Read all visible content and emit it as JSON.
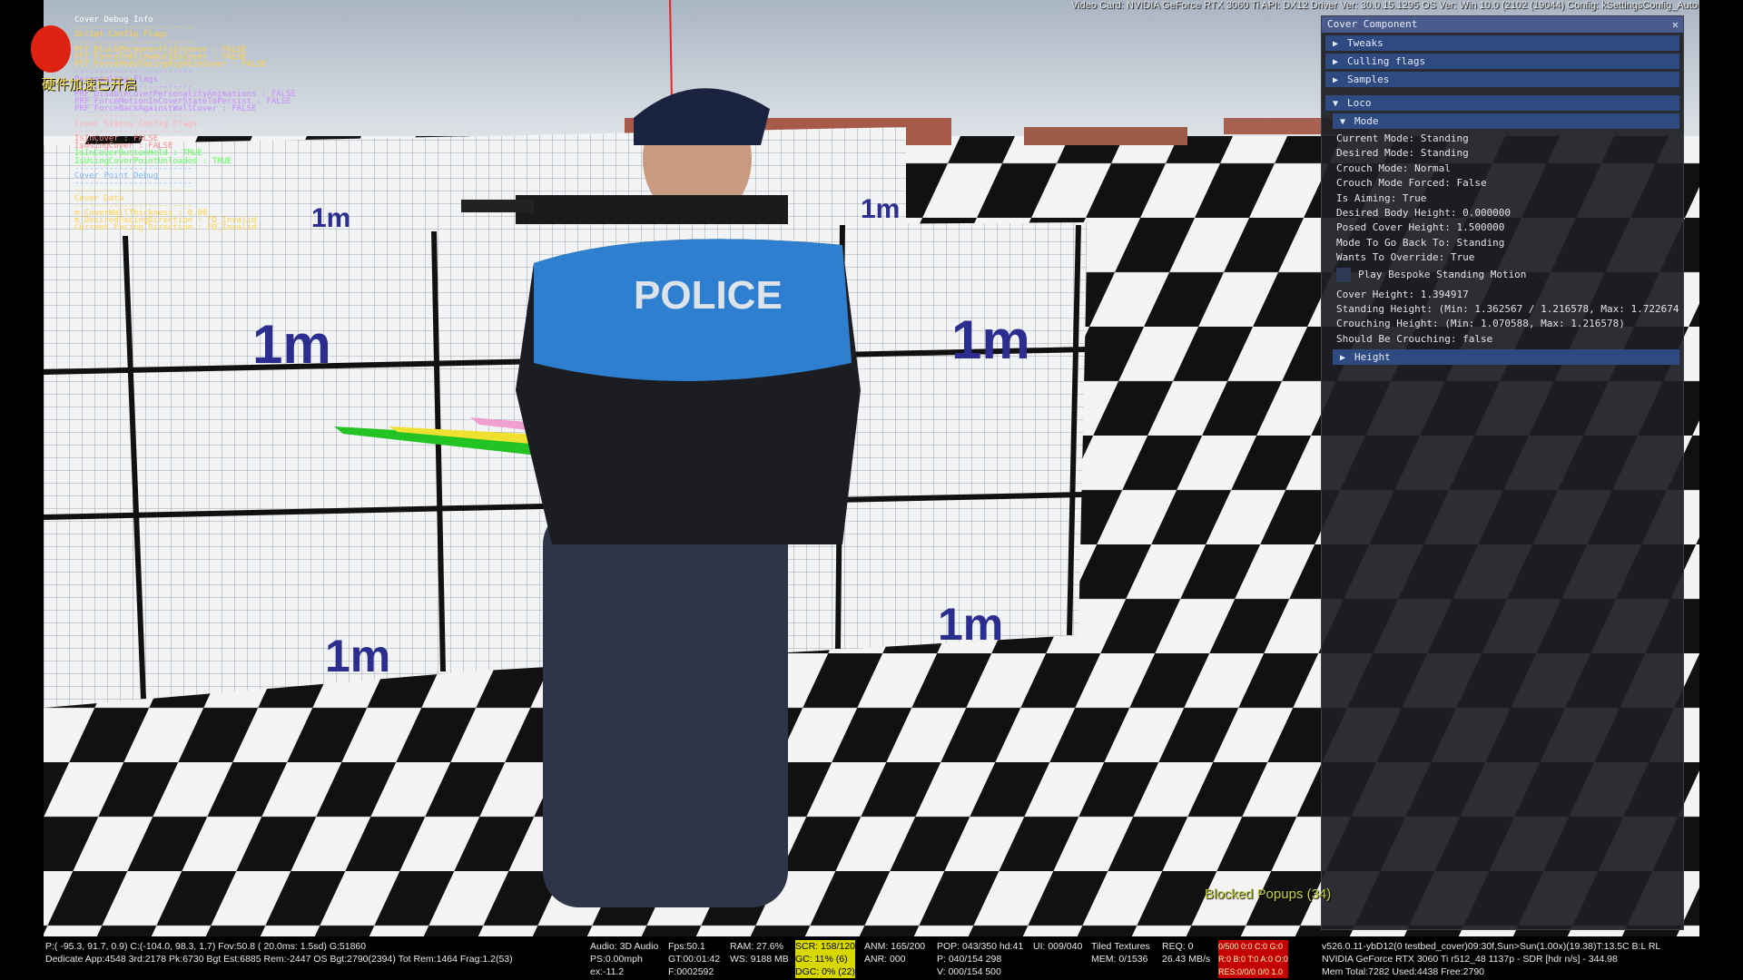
{
  "top_info": "Video Card: NVIDIA GeForce RTX 3060 Ti API: DX12 Driver Ver: 30.0.15.1295 OS Ver: Win 10.0 (2102 (19044) Config: kSettingsConfig_Auto",
  "ime_indicator": "硬件加速已开启",
  "debug_lines": [
    {
      "text": "Cover Debug Info",
      "color": "#ffffff"
    },
    {
      "text": "------------------------",
      "color": "#ffd24a"
    },
    {
      "text": "Script Config Flags",
      "color": "#ffd24a"
    },
    {
      "text": "------------------------",
      "color": "#ffd24a"
    },
    {
      "text": "PCF_BlockPermanentlyInCover : FALSE",
      "color": "#ffd24a"
    },
    {
      "text": "PCF_ForceToAllowAutoInCover : FALSE",
      "color": "#ffd24a"
    },
    {
      "text": "PCF_ForcePedsFacingRightInCover : FALSE",
      "color": "#ffd24a"
    },
    {
      "text": "------------------------",
      "color": "#c98bff"
    },
    {
      "text": "Personality Flags",
      "color": "#c98bff"
    },
    {
      "text": "------------------------",
      "color": "#c98bff"
    },
    {
      "text": "PRF_DisableCoverPersonalityAnimations : FALSE",
      "color": "#c98bff"
    },
    {
      "text": "PRF_ForceMotionInCoverStateToPersist : FALSE",
      "color": "#c98bff"
    },
    {
      "text": "PRF_ForceBackAgainstWallCover : FALSE",
      "color": "#c98bff"
    },
    {
      "text": "------------------------",
      "color": "#ffb0b0"
    },
    {
      "text": "Cover Status Config Flags",
      "color": "#ffb0b0"
    },
    {
      "text": "------------------------",
      "color": "#ffb0b0"
    },
    {
      "text": "IsInCover : FALSE",
      "color": "#ff8a8a"
    },
    {
      "text": "IsUsingCover : FALSE",
      "color": "#ff8a8a"
    },
    {
      "text": "IsInCoverButtonHeld : TRUE",
      "color": "#5cff5c"
    },
    {
      "text": "IsUsingCoverPointUnloaded : TRUE",
      "color": "#5cff5c"
    },
    {
      "text": "------------------------",
      "color": "#7fb6ff"
    },
    {
      "text": "Cover Point Debug",
      "color": "#7fb6ff"
    },
    {
      "text": "------------------------",
      "color": "#7fb6ff"
    },
    {
      "text": "------------------------",
      "color": "#ffd24a"
    },
    {
      "text": "Cover Data",
      "color": "#ffd24a"
    },
    {
      "text": "------------------------",
      "color": "#ffd24a"
    },
    {
      "text": "m_CoverWallThickness : 0.00",
      "color": "#ffd24a"
    },
    {
      "text": "m_DesiredFacingDirection : FD_Invalid",
      "color": "#ffd24a"
    },
    {
      "text": "Current Facing Direction : FD_Invalid",
      "color": "#ffd24a"
    }
  ],
  "panel": {
    "title": "Cover Component",
    "close_glyph": "✕",
    "collapsed_arrow": "▶",
    "expanded_arrow": "▼",
    "sections": {
      "tweaks": "Tweaks",
      "culling_flags": "Culling flags",
      "samples": "Samples",
      "loco": "Loco",
      "mode": "Mode",
      "height": "Height"
    },
    "mode_rows": [
      "Current Mode: Standing",
      "Desired Mode: Standing",
      "Crouch Mode: Normal",
      "Crouch Mode Forced: False",
      "Is Aiming: True",
      "Desired Body Height: 0.000000",
      "Posed Cover Height: 1.500000",
      "Mode To Go Back To: Standing",
      "Wants To Override: True"
    ],
    "checkbox_label": "Play Bespoke Standing Motion",
    "height_rows": [
      "Cover Height: 1.394917",
      "Standing Height: (Min: 1.362567 / 1.216578, Max: 1.722674",
      "Crouching Height: (Min: 1.070588, Max: 1.216578)",
      "Should Be Crouching: false"
    ]
  },
  "blocked_popups": "Blocked Popups (34)",
  "scene_labels": {
    "meter": "1m",
    "jersey": "POLICE"
  },
  "bottom": {
    "col1": [
      "P:( -95.3, 91.7, 0.9) C:(-104.0, 98.3, 1.7) Fov:50.8 ( 20.0ms: 1.5sd) G:51860",
      "Dedicate App:4548 3rd:2178 Pk:6730 Bgt Est:6885 Rem:-2447 OS Bgt:2790(2394) Tot Rem:1464 Frag:1.2(53)"
    ],
    "col2": [
      "Audio: 3D Audio",
      "PS:0.00mph",
      "ex:-11.2"
    ],
    "col3": [
      "Fps:50.1",
      "GT:00:01:42",
      "F:0002592"
    ],
    "col4": [
      "RAM: 27.6%",
      "WS: 9188 MB"
    ],
    "col5": [
      "SCR: 158/120",
      "GC: 11% (6)",
      "DGC: 0% (22)"
    ],
    "col6": [
      "ANM: 165/200",
      "ANR: 000"
    ],
    "col7": [
      "POP: 043/350 hd:41",
      "P: 040/154 298",
      "V: 000/154 500"
    ],
    "col8": [
      "UI: 009/040"
    ],
    "col9": [
      "Tiled Textures",
      "MEM: 0/1536"
    ],
    "col10": [
      "REQ: 0",
      "26.43 MB/s"
    ],
    "col11": [
      "0/500 0:0 C:0 G:0",
      "R:0 B:0 T:0 A:0 O:0",
      "RES:0/0/0 0/0 1.0"
    ],
    "col12": [
      "v526.0.11-ybD12(0 testbed_cover)09:30f,Sun>Sun(1.00x)(19.38)T:13.5C B:L RL",
      "NVIDIA GeForce RTX 3060 Ti r512_48 1137p - SDR [hdr n/s] - 344.98",
      "Mem Total:7282 Used:4438 Free:2790"
    ]
  }
}
